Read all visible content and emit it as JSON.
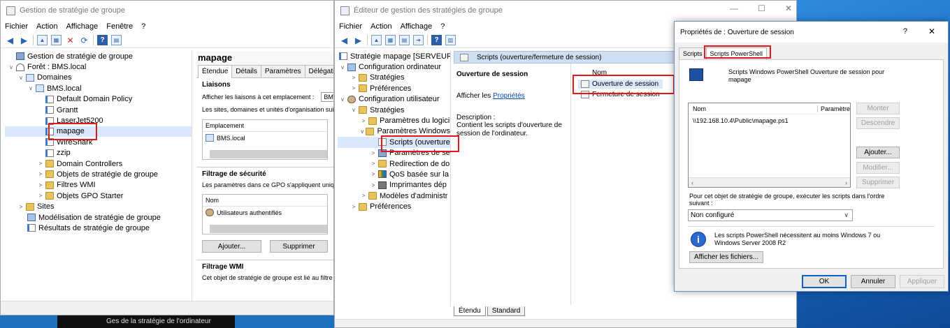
{
  "win1": {
    "title": "Gestion de stratégie de groupe",
    "menu": [
      "Fichier",
      "Action",
      "Affichage",
      "Fenêtre",
      "?"
    ],
    "tree": [
      {
        "label": "Gestion de stratégie de groupe",
        "icon": "gpm-icon"
      },
      {
        "label": "Forêt : BMS.local",
        "icon": "forest-icon"
      },
      {
        "label": "Domaines",
        "icon": "domains-icon"
      },
      {
        "label": "BMS.local",
        "icon": "domain-icon"
      },
      {
        "label": "Default Domain Policy",
        "icon": "gpo-icon"
      },
      {
        "label": "Grantt",
        "icon": "gpo-icon"
      },
      {
        "label": "LaserJet5200",
        "icon": "gpo-icon"
      },
      {
        "label": "mapage",
        "icon": "gpo-icon"
      },
      {
        "label": "WireShark",
        "icon": "gpo-icon"
      },
      {
        "label": "zzip",
        "icon": "gpo-icon"
      },
      {
        "label": "Domain Controllers",
        "icon": "folder-icon"
      },
      {
        "label": "Objets de stratégie de groupe",
        "icon": "folder-icon"
      },
      {
        "label": "Filtres WMI",
        "icon": "folder-icon"
      },
      {
        "label": "Objets GPO Starter",
        "icon": "folder-icon"
      },
      {
        "label": "Sites",
        "icon": "sites-icon"
      },
      {
        "label": "Modélisation de stratégie de groupe",
        "icon": "modeling-icon"
      },
      {
        "label": "Résultats de stratégie de groupe",
        "icon": "results-icon"
      }
    ],
    "detail": {
      "title": "mapage",
      "tabs": [
        "Étendue",
        "Détails",
        "Paramètres",
        "Délégation"
      ],
      "liaisons_heading": "Liaisons",
      "liaisons_label": "Afficher les liaisons à cet emplacement :",
      "liaisons_value": "BM",
      "liaisons_desc": "Les sites, domaines et unités d'organisation sui",
      "emplacement_header": "Emplacement",
      "emplacement_row": "BMS.local",
      "filtrage_heading": "Filtrage de sécurité",
      "filtrage_desc": "Les paramètres dans ce GPO s'appliquent uniq",
      "nom_header": "Nom",
      "nom_row": "Utilisateurs authentifiés",
      "add_button": "Ajouter...",
      "remove_button": "Supprimer",
      "wmi_heading": "Filtrage WMI",
      "wmi_desc": "Cet objet de stratégie de groupe est lié au filtre"
    }
  },
  "win2": {
    "title": "Éditeur de gestion des stratégies de groupe",
    "menu": [
      "Fichier",
      "Action",
      "Affichage",
      "?"
    ],
    "tree": [
      {
        "label": "Stratégie mapage [SERVEURDOI",
        "icon": "gpo-icon"
      },
      {
        "label": "Configuration ordinateur",
        "icon": "computer-icon"
      },
      {
        "label": "Stratégies",
        "icon": "folder-icon"
      },
      {
        "label": "Préférences",
        "icon": "folder-icon"
      },
      {
        "label": "Configuration utilisateur",
        "icon": "user-icon"
      },
      {
        "label": "Stratégies",
        "icon": "folder-icon"
      },
      {
        "label": "Paramètres du logici",
        "icon": "folder-icon"
      },
      {
        "label": "Paramètres Windows",
        "icon": "folder-icon"
      },
      {
        "label": "Scripts (ouverture",
        "icon": "script-icon"
      },
      {
        "label": "Paramètres de se",
        "icon": "security-icon"
      },
      {
        "label": "Redirection de do",
        "icon": "folder-icon"
      },
      {
        "label": "QoS basée sur la",
        "icon": "qos-icon"
      },
      {
        "label": "Imprimantes dép",
        "icon": "printer-icon"
      },
      {
        "label": "Modèles d'administr",
        "icon": "folder-icon"
      },
      {
        "label": "Préférences",
        "icon": "folder-icon"
      }
    ],
    "right": {
      "header": "Scripts (ouverture/fermeture de session)",
      "section_title": "Ouverture de session",
      "show_label": "Afficher les",
      "show_link": "Propriétés",
      "description_label": "Description :",
      "description_text": "Contient les scripts d'ouverture de session de l'ordinateur.",
      "col_name": "Nom",
      "items": [
        "Ouverture de session",
        "Fermeture de session"
      ]
    },
    "bottom_tabs": [
      "Étendu",
      "Standard"
    ]
  },
  "dialog": {
    "title": "Propriétés de : Ouverture de session",
    "help": "?",
    "close": "✕",
    "tabs": [
      "Scripts",
      "Scripts PowerShell"
    ],
    "heading": "Scripts Windows PowerShell Ouverture de session pour mapage",
    "col_name": "Nom",
    "col_params": "Paramètre",
    "scripts": [
      "\\\\192.168.10.4\\Public\\mapage.ps1"
    ],
    "side_buttons": [
      "Monter",
      "Descendre",
      "Ajouter...",
      "Modifier...",
      "Supprimer"
    ],
    "order_label": "Pour cet objet de stratégie de groupe, exécuter les scripts dans l'ordre suivant :",
    "order_value": "Non configuré",
    "info_text": "Les scripts PowerShell nécessitent au moins Windows 7 ou Windows Server 2008 R2",
    "show_files": "Afficher les fichiers...",
    "ok": "OK",
    "cancel": "Annuler",
    "apply": "Appliquer"
  },
  "win2_controls": {
    "minimize": "—",
    "maximize": "☐",
    "close": "✕"
  },
  "taskbar_text": "Ges  de la stratégie de l'ordinateur"
}
